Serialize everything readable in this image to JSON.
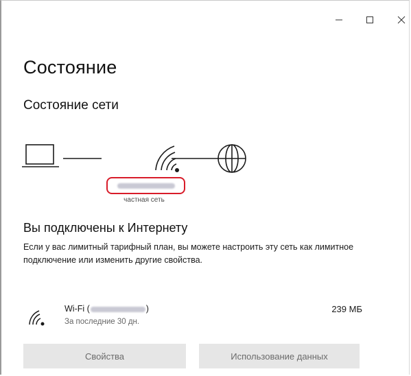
{
  "window": {
    "controls": {
      "minimize_icon": "minimize-icon",
      "maximize_icon": "maximize-icon",
      "close_icon": "close-icon"
    }
  },
  "page": {
    "title": "Состояние",
    "section_title": "Состояние сети"
  },
  "diagram": {
    "icons": [
      "laptop-icon",
      "wifi-icon",
      "globe-icon"
    ],
    "network_type": "частная сеть"
  },
  "connection": {
    "title": "Вы подключены к Интернету",
    "description": "Если у вас лимитный тарифный план, вы можете настроить эту сеть как лимитное подключение или изменить другие свойства."
  },
  "wifi": {
    "name_prefix": "Wi-Fi (",
    "name_suffix": ")",
    "period": "За последние 30 дн.",
    "usage": "239 МБ"
  },
  "buttons": {
    "properties": "Свойства",
    "data_usage": "Использование данных"
  },
  "colors": {
    "highlight": "#d81b29",
    "button_bg": "#e6e6e6",
    "button_text": "#6b6b6b",
    "blur_fill": "#c9c9d4"
  }
}
